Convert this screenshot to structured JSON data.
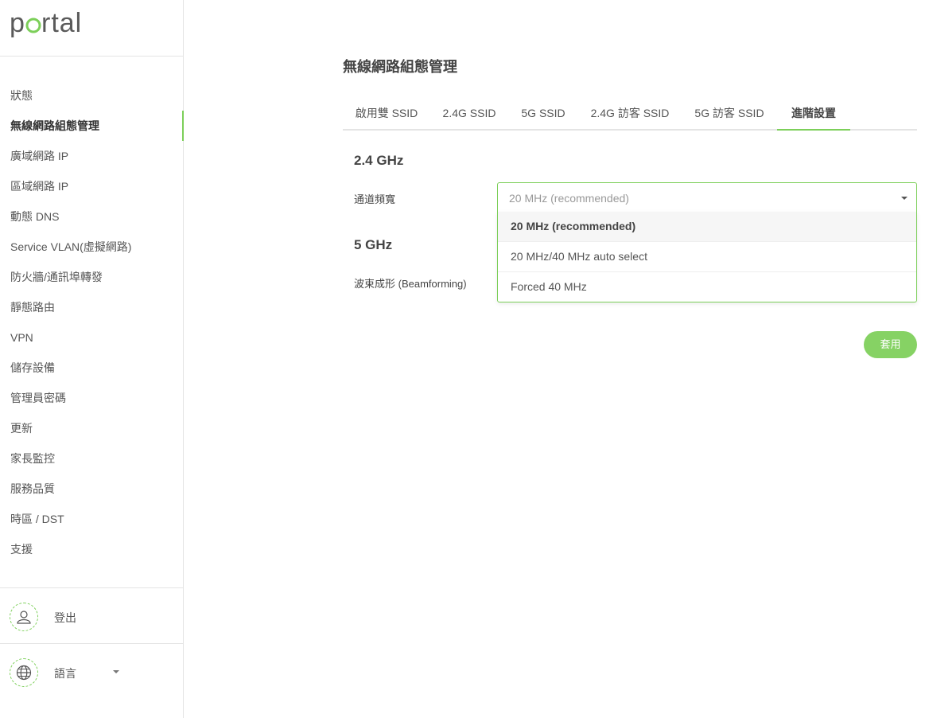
{
  "app": {
    "logo_text": "portal",
    "accent_color": "#7ccf59"
  },
  "sidebar": {
    "items": [
      {
        "label": "狀態",
        "active": false
      },
      {
        "label": "無線網路組態管理",
        "active": true
      },
      {
        "label": "廣域網路 IP",
        "active": false
      },
      {
        "label": "區域網路 IP",
        "active": false
      },
      {
        "label": "動態 DNS",
        "active": false
      },
      {
        "label": "Service VLAN(虛擬網路)",
        "active": false
      },
      {
        "label": "防火牆/通訊埠轉發",
        "active": false
      },
      {
        "label": "靜態路由",
        "active": false
      },
      {
        "label": "VPN",
        "active": false
      },
      {
        "label": "儲存設備",
        "active": false
      },
      {
        "label": "管理員密碼",
        "active": false
      },
      {
        "label": "更新",
        "active": false
      },
      {
        "label": "家長監控",
        "active": false
      },
      {
        "label": "服務品質",
        "active": false
      },
      {
        "label": "時區 / DST",
        "active": false
      },
      {
        "label": "支援",
        "active": false
      }
    ],
    "logout": {
      "label": "登出",
      "icon": "user-icon"
    },
    "language": {
      "label": "語言",
      "icon": "globe-icon"
    }
  },
  "main": {
    "title": "無線網路組態管理",
    "tabs": [
      {
        "label": "啟用雙 SSID"
      },
      {
        "label": "2.4G SSID"
      },
      {
        "label": "5G SSID"
      },
      {
        "label": "2.4G 訪客 SSID"
      },
      {
        "label": "5G 訪客 SSID"
      },
      {
        "label": "進階設置"
      }
    ],
    "active_tab": 5,
    "section_24": {
      "title": "2.4 GHz",
      "channel_width_label": "通道頻寬",
      "channel_width_value": "20 MHz (recommended)",
      "options": [
        "20 MHz (recommended)",
        "20 MHz/40 MHz auto select",
        "Forced 40 MHz"
      ],
      "selected_option": 0
    },
    "section_5": {
      "title": "5 GHz",
      "beamforming_label": "波束成形 (Beamforming)"
    },
    "apply_label": "套用"
  }
}
